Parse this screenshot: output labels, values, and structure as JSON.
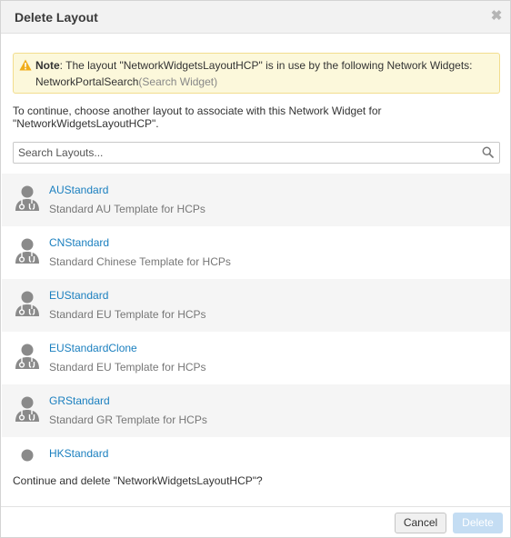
{
  "dialog": {
    "title": "Delete Layout",
    "close_glyph": "✖",
    "close_icon": "close-icon"
  },
  "note": {
    "icon": "warning-icon",
    "label": "Note",
    "message": ": The layout \"NetworkWidgetsLayoutHCP\" is in use by the following Network Widgets:",
    "widget_name": "NetworkPortalSearch",
    "widget_type": "(Search Widget)"
  },
  "instruction": "To continue, choose another layout to associate with this Network Widget for \"NetworkWidgetsLayoutHCP\".",
  "search": {
    "placeholder": "Search Layouts...",
    "value": "",
    "icon": "search-icon"
  },
  "layouts": [
    {
      "name": "AUStandard",
      "description": "Standard AU Template for HCPs"
    },
    {
      "name": "CNStandard",
      "description": "Standard Chinese Template for HCPs"
    },
    {
      "name": "EUStandard",
      "description": "Standard EU Template for HCPs"
    },
    {
      "name": "EUStandardClone",
      "description": "Standard EU Template for HCPs"
    },
    {
      "name": "GRStandard",
      "description": "Standard GR Template for HCPs"
    },
    {
      "name": "HKStandard",
      "description": ""
    }
  ],
  "confirm_text": "Continue and delete \"NetworkWidgetsLayoutHCP\"?",
  "footer": {
    "cancel_label": "Cancel",
    "delete_label": "Delete"
  },
  "colors": {
    "link": "#1a7fbf",
    "note_bg": "#fcf8db",
    "note_border": "#f2dd8e",
    "delete_disabled": "#c4ddf3",
    "warning": "#f0ad1a"
  }
}
